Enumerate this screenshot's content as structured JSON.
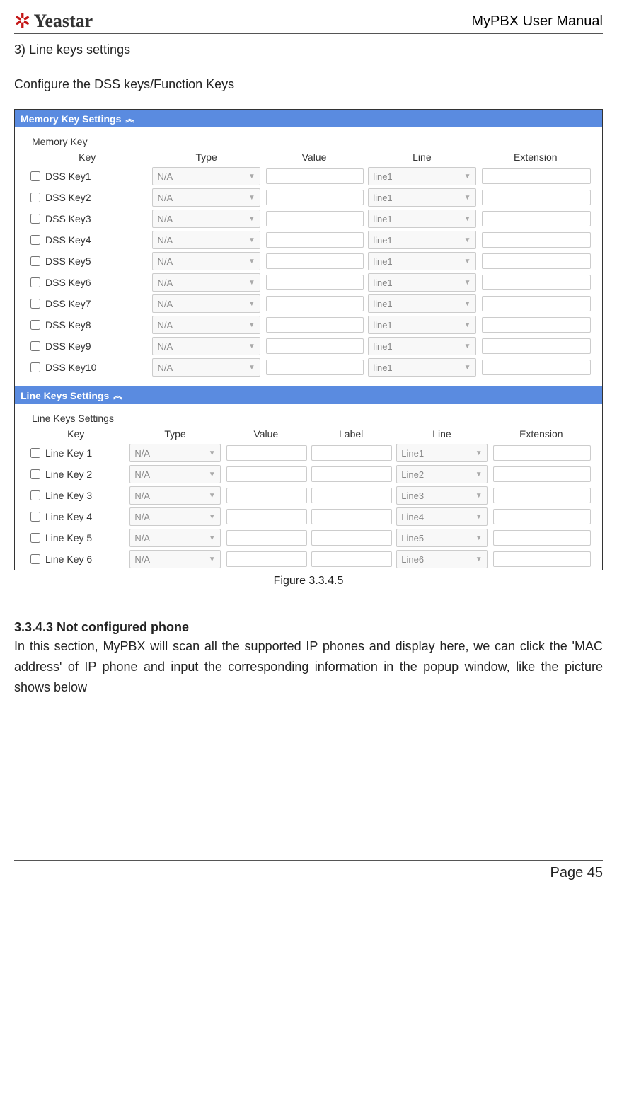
{
  "header": {
    "brand": "Yeastar",
    "doc_title": "MyPBX User Manual"
  },
  "section": {
    "number_label": "3)  Line keys settings",
    "intro": "Configure the DSS keys/Function Keys"
  },
  "screenshot": {
    "memory_panel_title": "Memory Key Settings",
    "memory_sub": "Memory Key",
    "mem_headers": {
      "key": "Key",
      "type": "Type",
      "value": "Value",
      "line": "Line",
      "ext": "Extension"
    },
    "mem_rows": [
      {
        "key": "DSS Key1",
        "type": "N/A",
        "line": "line1"
      },
      {
        "key": "DSS Key2",
        "type": "N/A",
        "line": "line1"
      },
      {
        "key": "DSS Key3",
        "type": "N/A",
        "line": "line1"
      },
      {
        "key": "DSS Key4",
        "type": "N/A",
        "line": "line1"
      },
      {
        "key": "DSS Key5",
        "type": "N/A",
        "line": "line1"
      },
      {
        "key": "DSS Key6",
        "type": "N/A",
        "line": "line1"
      },
      {
        "key": "DSS Key7",
        "type": "N/A",
        "line": "line1"
      },
      {
        "key": "DSS Key8",
        "type": "N/A",
        "line": "line1"
      },
      {
        "key": "DSS Key9",
        "type": "N/A",
        "line": "line1"
      },
      {
        "key": "DSS Key10",
        "type": "N/A",
        "line": "line1"
      }
    ],
    "line_panel_title": "Line Keys Settings",
    "line_sub": "Line Keys Settings",
    "line_headers": {
      "key": "Key",
      "type": "Type",
      "value": "Value",
      "label": "Label",
      "line": "Line",
      "ext": "Extension"
    },
    "line_rows": [
      {
        "key": "Line Key 1",
        "type": "N/A",
        "line": "Line1"
      },
      {
        "key": "Line Key 2",
        "type": "N/A",
        "line": "Line2"
      },
      {
        "key": "Line Key 3",
        "type": "N/A",
        "line": "Line3"
      },
      {
        "key": "Line Key 4",
        "type": "N/A",
        "line": "Line4"
      },
      {
        "key": "Line Key 5",
        "type": "N/A",
        "line": "Line5"
      },
      {
        "key": "Line Key 6",
        "type": "N/A",
        "line": "Line6"
      }
    ]
  },
  "figure_caption": "Figure 3.3.4.5",
  "subsection": {
    "title": "3.3.4.3 Not configured phone",
    "body": "In this section, MyPBX will scan all the supported IP phones and display here, we can click the 'MAC address' of IP phone and input the corresponding information in the popup window, like the picture shows below"
  },
  "footer": {
    "page": "Page 45"
  }
}
